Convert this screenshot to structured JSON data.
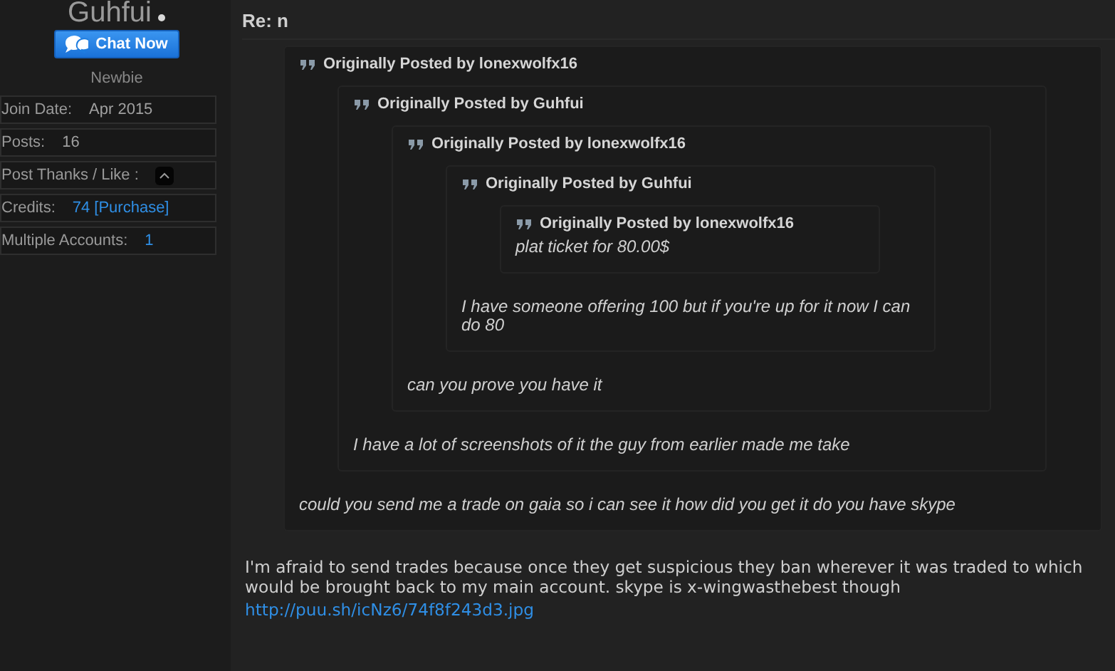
{
  "user": {
    "name": "Guhfui",
    "online": true,
    "chat_button": "Chat Now",
    "rank": "Newbie",
    "stats": [
      {
        "kind": "text",
        "label": "Join Date:",
        "value": "Apr 2015"
      },
      {
        "kind": "text",
        "label": "Posts:",
        "value": "16"
      },
      {
        "kind": "toggle",
        "label": "Post Thanks / Like :"
      },
      {
        "kind": "credits",
        "label": "Credits:",
        "value": "74",
        "link": "[Purchase]"
      },
      {
        "kind": "link",
        "label": "Multiple Accounts:",
        "value": "1"
      }
    ]
  },
  "post": {
    "title": "Re: n",
    "quote": {
      "heading": "Originally Posted by lonexwolfx16",
      "text": "could you send me a trade on gaia so i can see it how did you get it do you have skype",
      "quote": {
        "heading": "Originally Posted by Guhfui",
        "text": "I have a lot of screenshots of it the guy from earlier made me take",
        "quote": {
          "heading": "Originally Posted by lonexwolfx16",
          "text": "can you prove you have it",
          "quote": {
            "heading": "Originally Posted by Guhfui",
            "text": "I have someone offering 100 but if you're up for it now I can do 80",
            "quote": {
              "heading": "Originally Posted by lonexwolfx16",
              "text": "plat ticket for 80.00$"
            }
          }
        }
      }
    },
    "body": "I'm afraid to send trades because once they get suspicious they ban wherever it was traded to which would be brought back to my main account. skype is x-wingwasthebest though",
    "link": "http://puu.sh/icNz6/74f8f243d3.jpg"
  }
}
